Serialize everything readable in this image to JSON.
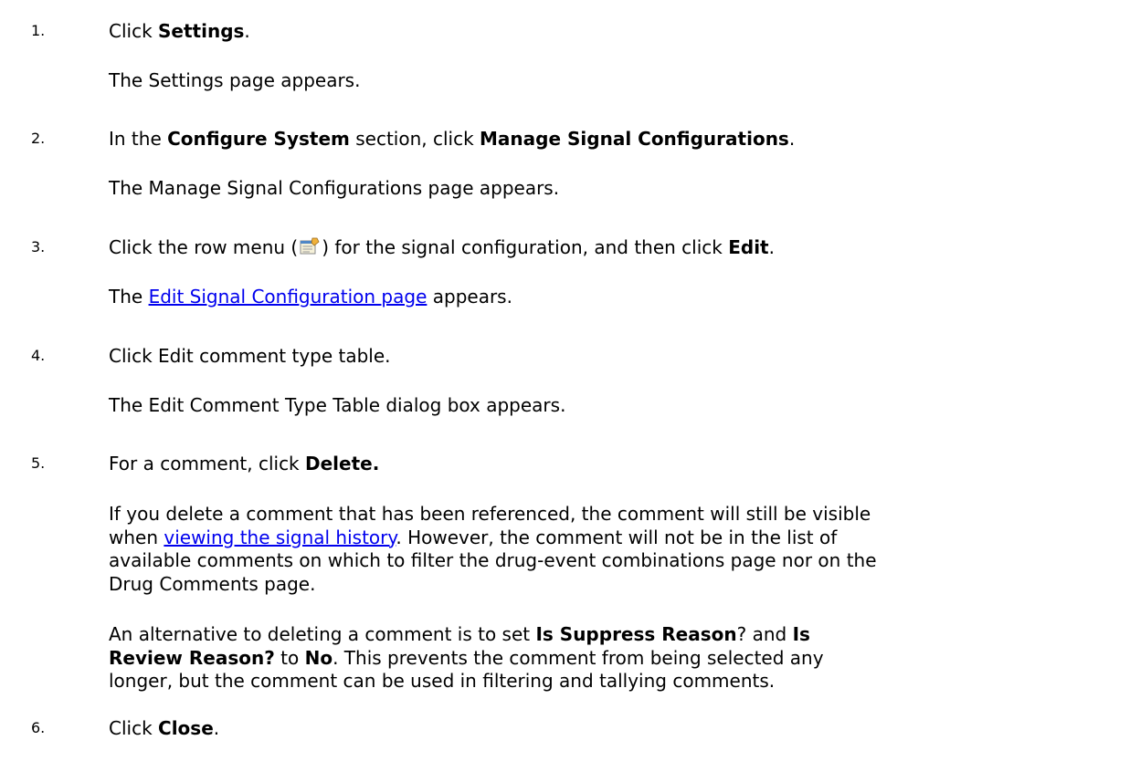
{
  "steps": [
    {
      "number": "1.",
      "parts": [
        "Click ",
        "Settings",
        "."
      ],
      "result": "The Settings page appears."
    },
    {
      "number": "2.",
      "parts": [
        "In the ",
        "Configure System",
        " section, click ",
        "Manage Signal Configurations",
        "."
      ],
      "result": "The Manage Signal Configurations page appears."
    },
    {
      "number": "3.",
      "parts": [
        "Click the row menu (",
        ") for the signal configuration, and then click ",
        "Edit",
        "."
      ],
      "result_prefix": "The ",
      "result_link": "Edit Signal Configuration page",
      "result_suffix": " appears."
    },
    {
      "number": "4.",
      "text": "Click Edit comment type table.",
      "result": "The Edit Comment Type Table dialog box appears."
    },
    {
      "number": "5.",
      "parts": [
        "For a comment, click ",
        "Delete."
      ],
      "note1": {
        "line1": "If you delete a comment that has been referenced, the comment will still be visible",
        "line2_prefix": "when ",
        "line2_link": "viewing the signal history",
        "line2_suffix": ". However, the comment will not be in the list of",
        "line3": "available comments on which to filter the drug-event combinations page nor on the",
        "line4": "Drug Comments page."
      },
      "note2": {
        "l1_a": "An alternative to deleting a comment is to set ",
        "l1_b": "Is Suppress Reason",
        "l1_c": "? and ",
        "l1_d": "Is",
        "l2_a": "Review Reason?",
        "l2_b": " to ",
        "l2_c": "No",
        "l2_d": ". This prevents the comment from being selected any",
        "line3": "longer, but the comment can be used in filtering and tallying comments."
      }
    },
    {
      "number": "6.",
      "parts": [
        "Click ",
        "Close",
        "."
      ]
    }
  ],
  "icons": {
    "row_menu": "row-menu-icon"
  }
}
